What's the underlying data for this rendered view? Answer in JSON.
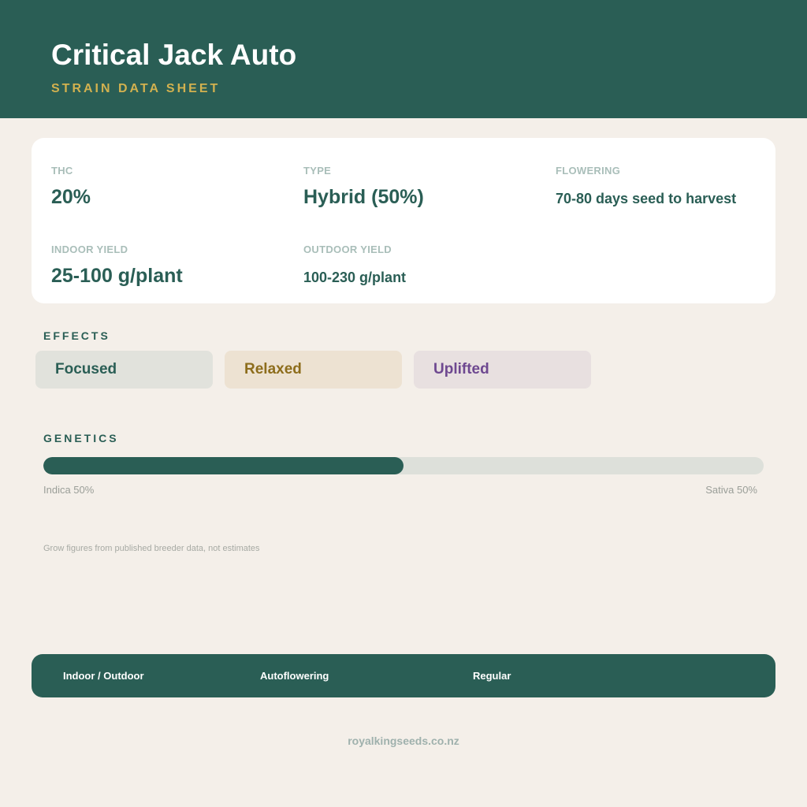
{
  "header": {
    "title": "Critical Jack Auto",
    "subtitle": "STRAIN DATA SHEET"
  },
  "stats": {
    "thc": {
      "label": "THC",
      "value": "20%"
    },
    "type": {
      "label": "TYPE",
      "value": "Hybrid (50%)"
    },
    "flowering": {
      "label": "FLOWERING",
      "value": "70-80 days seed to harvest"
    },
    "indoor_yield": {
      "label": "INDOOR YIELD",
      "value": "25-100 g/plant"
    },
    "outdoor_yield": {
      "label": "OUTDOOR YIELD",
      "value": "100-230 g/plant"
    }
  },
  "effects": {
    "heading": "EFFECTS",
    "items": [
      "Focused",
      "Relaxed",
      "Uplifted"
    ]
  },
  "genetics": {
    "heading": "GENETICS",
    "indica_label": "Indica 50%",
    "sativa_label": "Sativa 50%",
    "indica_fraction": 0.5
  },
  "note": "Grow figures from published breeder data, not estimates",
  "footer": {
    "items": [
      "Indoor / Outdoor",
      "Autoflowering",
      "Regular"
    ]
  },
  "site": "royalkingseeds.co.nz",
  "colors": {
    "primary": "#2a5e55",
    "accent_gold": "#d2b14f",
    "background": "#f4efe9"
  }
}
